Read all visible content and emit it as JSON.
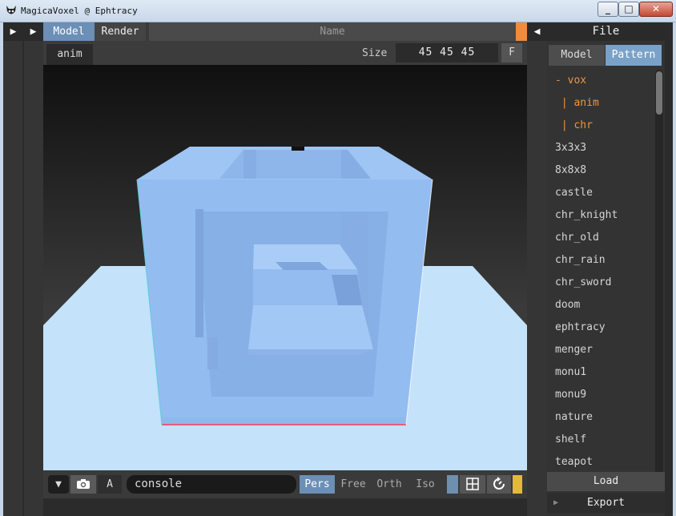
{
  "window": {
    "title": "MagicaVoxel @ Ephtracy",
    "minimize_icon": "minimize-icon",
    "maximize_icon": "maximize-icon",
    "close_icon": "close-icon"
  },
  "topbar": {
    "tabs": [
      {
        "label": "Model"
      },
      {
        "label": "Render"
      }
    ],
    "name_placeholder": "Name"
  },
  "subbar": {
    "anim_tab": "anim",
    "size_label": "Size",
    "size_value": "45 45 45",
    "f_button": "F"
  },
  "bottombar": {
    "a_button": "A",
    "console_value": "console",
    "views": [
      {
        "label": "Pers",
        "active": true
      },
      {
        "label": "Free",
        "active": false
      },
      {
        "label": "Orth",
        "active": false
      },
      {
        "label": "Iso",
        "active": false
      }
    ]
  },
  "right_panel": {
    "title": "File",
    "tabs": [
      {
        "label": "Model"
      },
      {
        "label": "Pattern"
      }
    ],
    "items": [
      {
        "label": "- vox",
        "color": "orange"
      },
      {
        "label": " | anim",
        "color": "orange"
      },
      {
        "label": " | chr",
        "color": "orange"
      },
      {
        "label": "3x3x3"
      },
      {
        "label": "8x8x8"
      },
      {
        "label": "castle"
      },
      {
        "label": "chr_knight"
      },
      {
        "label": "chr_old"
      },
      {
        "label": "chr_rain"
      },
      {
        "label": "chr_sword"
      },
      {
        "label": "doom"
      },
      {
        "label": "ephtracy"
      },
      {
        "label": "menger"
      },
      {
        "label": "monu1"
      },
      {
        "label": "monu9"
      },
      {
        "label": "nature"
      },
      {
        "label": "shelf"
      },
      {
        "label": "teapot"
      }
    ],
    "load_label": "Load",
    "export_label": "Export"
  },
  "colors": {
    "accent_blue": "#6b8fb6",
    "accent_orange": "#f08c3c",
    "ground": "#c6e4fb",
    "cube": "#9fc6f7"
  }
}
